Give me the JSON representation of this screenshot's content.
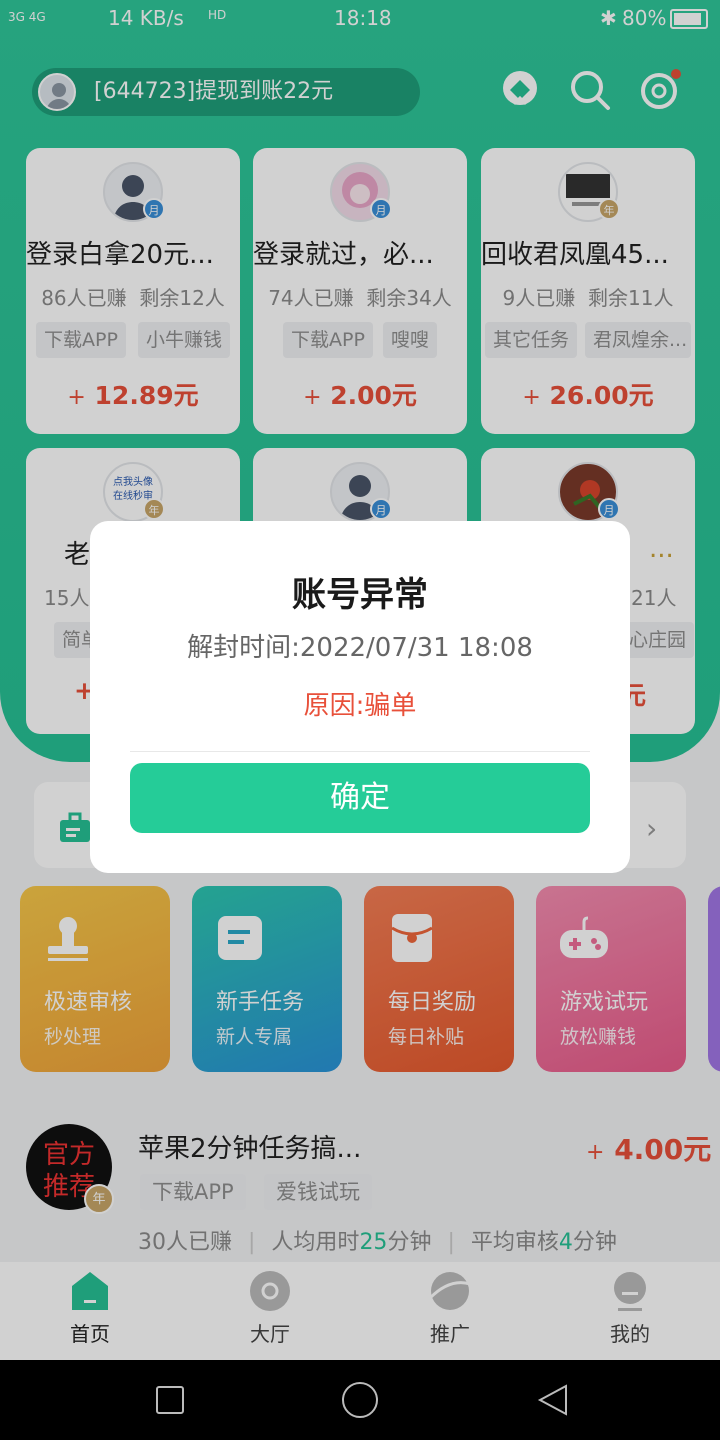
{
  "status_bar": {
    "signal": "3G 4G",
    "speed": "14 KB/s",
    "hd": "HD",
    "time": "18:18",
    "battery": "80%"
  },
  "header": {
    "notice": "[644723]提现到账22元"
  },
  "cards": [
    {
      "title": "登录白拿20元...",
      "earned": "86人已赚",
      "remaining": "剩余12人",
      "tag1": "下载APP",
      "tag2": "小牛赚钱",
      "plus": "+",
      "price": "12.89元"
    },
    {
      "title": "登录就过，必...",
      "earned": "74人已赚",
      "remaining": "剩余34人",
      "tag1": "下载APP",
      "tag2": "嗖嗖",
      "plus": "+",
      "price": "2.00元"
    },
    {
      "title": "回收君凤凰45...",
      "earned": "9人已赚",
      "remaining": "剩余11人",
      "tag1": "其它任务",
      "tag2": "君凤煌余...",
      "plus": "+",
      "price": "26.00元"
    },
    {
      "title": "老",
      "earned": "15人",
      "tag1": "简单",
      "plus": "+",
      "avatar_text": "点我头像在线秒审"
    },
    {
      "title": ""
    },
    {
      "title": "...",
      "remaining": "21人",
      "tag2": "心庄园",
      "price": "元"
    }
  ],
  "tiles": [
    {
      "title": "极速审核",
      "sub": "秒处理",
      "color": "#f2b23a"
    },
    {
      "title": "新手任务",
      "sub": "新人专属",
      "color": "#1fb8b0"
    },
    {
      "title": "每日奖励",
      "sub": "每日补贴",
      "color": "#f0673b"
    },
    {
      "title": "游戏试玩",
      "sub": "放松赚钱",
      "color": "#ef6f9a"
    }
  ],
  "task": {
    "avatar_line1": "官方",
    "avatar_line2": "推荐",
    "title": "苹果2分钟任务搞...",
    "tag1": "下载APP",
    "tag2": "爱钱试玩",
    "plus": "+",
    "price": "4.00元",
    "earned": "30人已赚",
    "avg_time_pre": "人均用时",
    "avg_time_val": "25",
    "avg_time_unit": "分钟",
    "avg_review_pre": "平均审核",
    "avg_review_val": "4",
    "avg_review_unit": "分钟"
  },
  "tabs": [
    {
      "label": "首页"
    },
    {
      "label": "大厅"
    },
    {
      "label": "推广"
    },
    {
      "label": "我的"
    }
  ],
  "dialog": {
    "title": "账号异常",
    "unseal": "解封时间:2022/07/31 18:08",
    "reason": "原因:骗单",
    "confirm": "确定"
  }
}
